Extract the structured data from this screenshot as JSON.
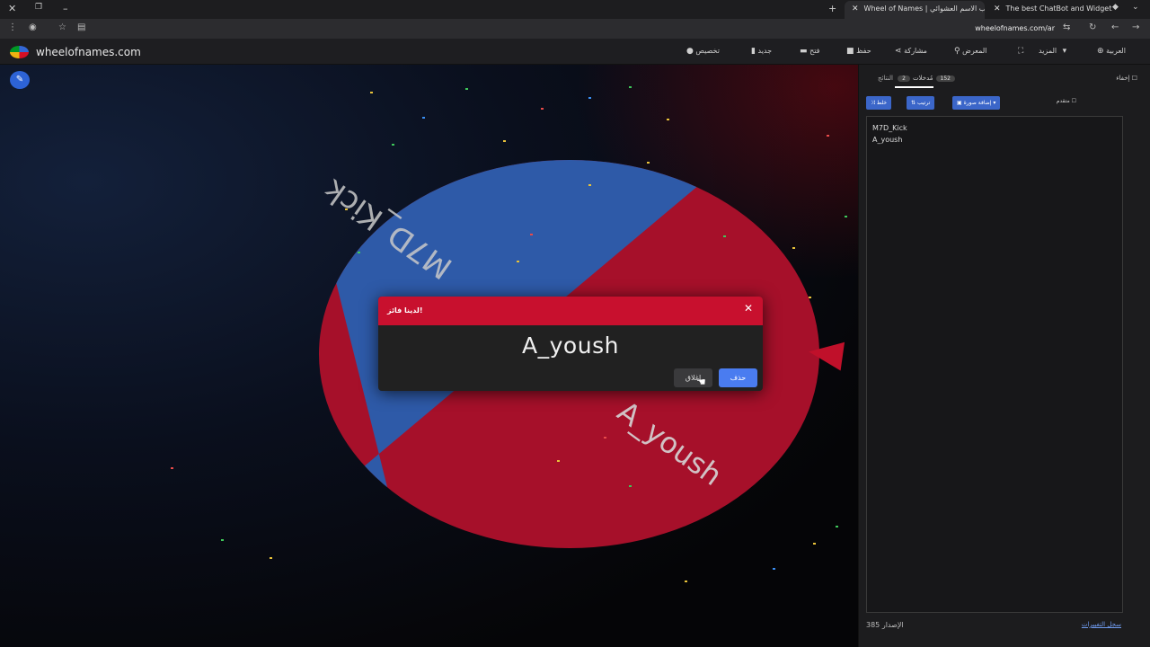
{
  "browser": {
    "tabs": [
      {
        "title": "Wheel of Names | دولاب الاسم العشوائي",
        "active": true
      },
      {
        "title": "The best ChatBot and Widgets",
        "active": false
      }
    ],
    "new_tab": "+",
    "url": "wheelofnames.com/ar"
  },
  "app": {
    "site_name": "wheelofnames.com",
    "menu": {
      "customize": "تخصيص",
      "new": "جديد",
      "open": "فتح",
      "save": "حفظ",
      "share": "مشاركة",
      "gallery": "المعرض",
      "more": "المزيد",
      "language": "العربية"
    }
  },
  "wheel": {
    "segments": [
      {
        "label": "M7D_Kick",
        "color": "#2e5aa8"
      },
      {
        "label": "A_yoush",
        "color": "#a6102a"
      }
    ]
  },
  "dialog": {
    "title": "لدينا فائز!",
    "winner": "A_yoush",
    "remove_label": "حذف",
    "close_label": "إغلاق"
  },
  "sidebar": {
    "hide_label": "إخفاء",
    "tab_entries": "مُدخلات",
    "entries_count": "2",
    "tab_results": "النتائج",
    "results_count": "152",
    "shuffle_label": "خلط",
    "sort_label": "ترتيب",
    "add_image_label": "إضافة صورة",
    "advanced_label": "متقدم",
    "entries": [
      "M7D_Kick",
      "A_yoush"
    ],
    "version": "الإصدار 385",
    "changelog": "سجل التغييرات"
  },
  "colors": {
    "accent": "#4a7cf0",
    "header_red": "#c8102e"
  }
}
